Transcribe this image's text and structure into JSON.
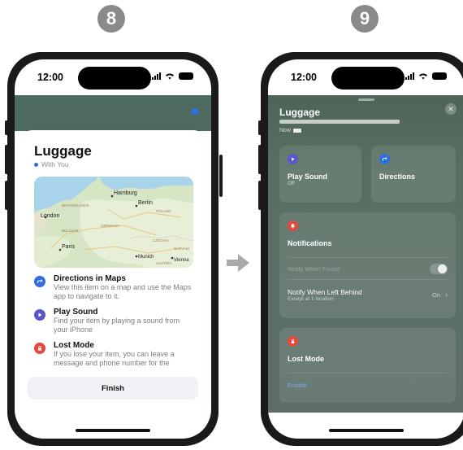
{
  "steps": {
    "left": "8",
    "right": "9"
  },
  "status": {
    "time": "12:00"
  },
  "phone8": {
    "title": "Luggage",
    "with_you": "With You",
    "map_labels": {
      "hamburg": "Hamburg",
      "berlin": "Berlin",
      "london": "London",
      "netherlands": "NETHERLANDS",
      "poland": "POLAND",
      "germany": "GERMANY",
      "belgium": "BELGIUM",
      "paris": "Paris",
      "czechia": "CZECHIA",
      "munich": "Munich",
      "vienna": "Vienna",
      "austria": "AUSTRIA",
      "slovakia": "SLOVAKI"
    },
    "features": [
      {
        "title": "Directions in Maps",
        "desc": "View this item on a map and use the Maps app to navigate to it.",
        "icon": "directions-icon",
        "color": "#2f6fe0"
      },
      {
        "title": "Play Sound",
        "desc": "Find your item by playing a sound from your iPhone",
        "icon": "play-icon",
        "color": "#5b57c9"
      },
      {
        "title": "Lost Mode",
        "desc": "If you lose your item, you can leave a message and phone number for the",
        "icon": "lock-icon",
        "color": "#e5483d"
      }
    ],
    "finish_label": "Finish"
  },
  "phone9": {
    "title": "Luggage",
    "now": "Now",
    "play_sound": {
      "label": "Play Sound",
      "sub": "Off"
    },
    "directions": {
      "label": "Directions"
    },
    "notifications": {
      "title": "Notifications",
      "notify_found": "Notify When Found",
      "left_behind": "Notify When Left Behind",
      "left_behind_sub": "Except at 1 location",
      "left_behind_value": "On"
    },
    "lost_mode": {
      "title": "Lost Mode",
      "enable": "Enable"
    },
    "colors": {
      "play": "#5b57c9",
      "directions": "#2f6fe0",
      "notify": "#e5483d",
      "lost": "#e5483d"
    }
  }
}
